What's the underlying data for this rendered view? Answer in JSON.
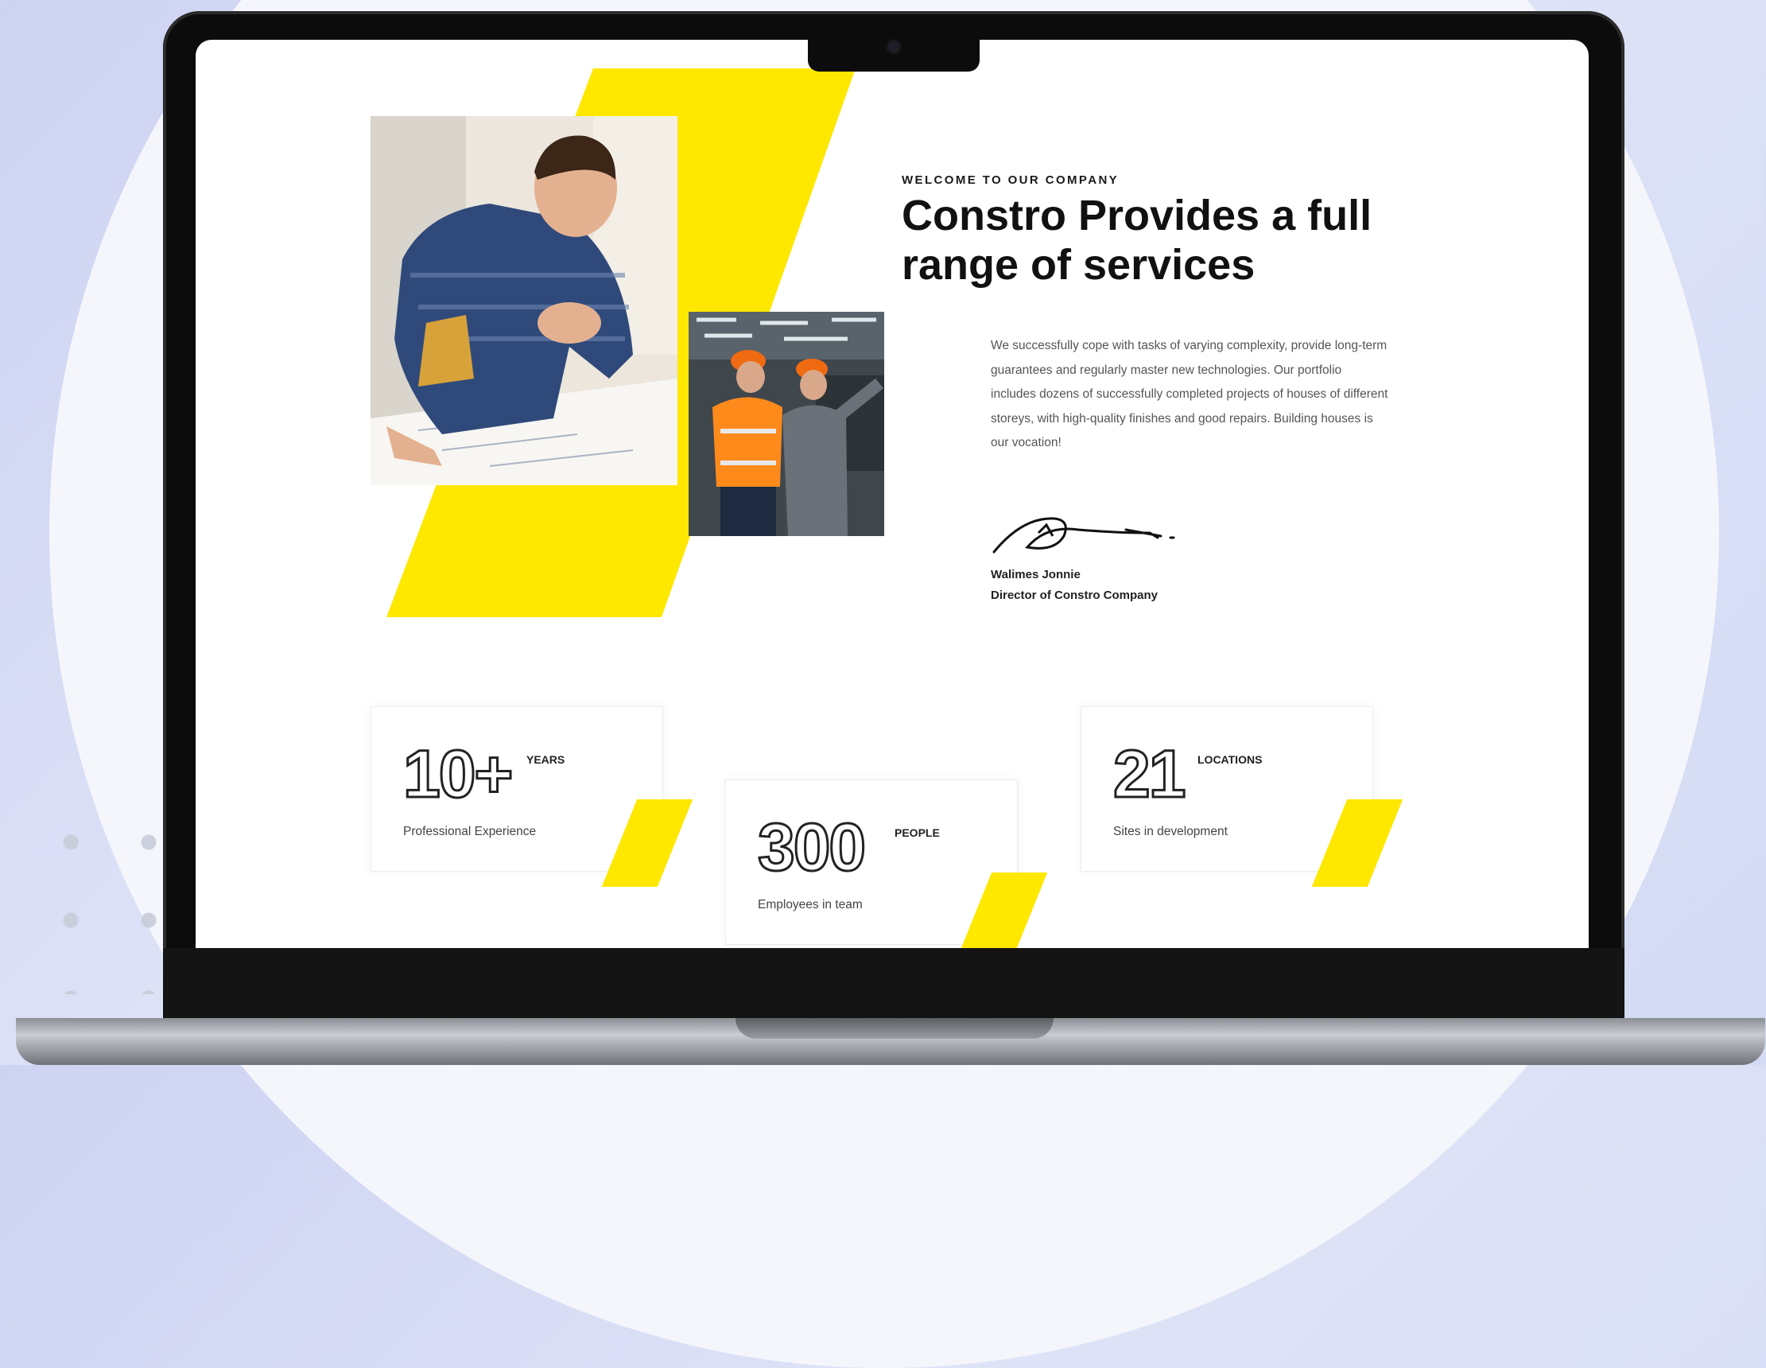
{
  "about": {
    "eyebrow": "WELCOME TO OUR COMPANY",
    "headline": "Constro Provides a full range of services",
    "paragraph": "We successfully cope with tasks of varying complexity, provide long-term guarantees and regularly master new technologies. Our portfolio includes dozens of successfully completed projects of houses of different storeys, with high-quality finishes and good repairs. Building houses is our vocation!",
    "signer_name": "Walimes Jonnie",
    "signer_role": "Director of Constro Company"
  },
  "stats": [
    {
      "number": "10+",
      "unit": "YEARS",
      "description": "Professional Experience"
    },
    {
      "number": "300",
      "unit": "PEOPLE",
      "description": "Employees in team"
    },
    {
      "number": "21",
      "unit": "LOCATIONS",
      "description": "Sites in development"
    }
  ],
  "colors": {
    "accent": "#ffe800",
    "text": "#111111",
    "background": "#ffffff"
  }
}
